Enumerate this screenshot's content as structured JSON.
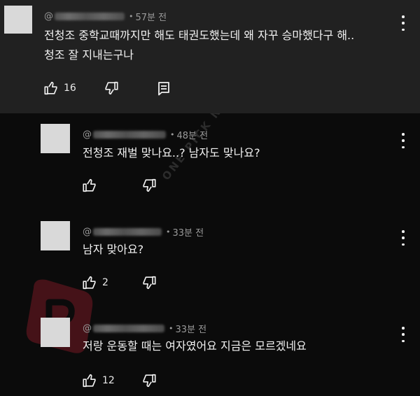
{
  "watermark": {
    "text": "ONE PICK NEWS"
  },
  "comments": [
    {
      "handle_prefix": "@",
      "time": "57분 전",
      "line1": "전청조 중학교때까지만 해도 태권도했는데 왜 자꾸 승마했다구 해..",
      "line2": "청조 잘 지내는구나",
      "likes": "16"
    },
    {
      "handle_prefix": "@",
      "time": "48분 전",
      "line1": "전청조 재벌 맞나요..? 남자도 맞나요?",
      "likes": ""
    },
    {
      "handle_prefix": "@",
      "time": "33분 전",
      "line1": "남자 맞아요?",
      "likes": "2"
    },
    {
      "handle_prefix": "@",
      "time": "33분 전",
      "line1": "저랑 운동할 때는 여자였어요 지금은 모르겠네요",
      "likes": "12"
    }
  ],
  "icons": {
    "like": "thumbs-up-icon",
    "dislike": "thumbs-down-icon",
    "reply": "reply-comment-icon",
    "more": "more-vertical-icon"
  },
  "colors": {
    "top_comment_bg": "#212121",
    "page_bg": "#0b0b0b",
    "text": "#f1f1f1",
    "meta": "#9a9a9a"
  }
}
